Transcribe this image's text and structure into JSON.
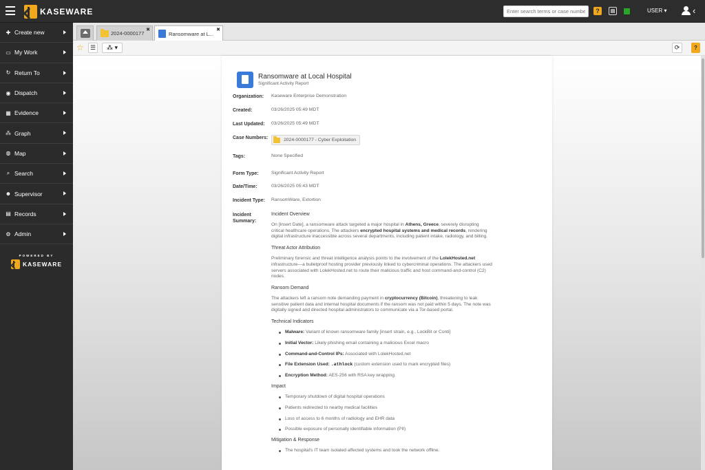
{
  "header": {
    "brand": "KASEWARE",
    "search_placeholder": "Enter search terms or case number",
    "help_icon": "?",
    "user_label": "USER"
  },
  "sidebar": {
    "items": [
      {
        "label": "Create new",
        "icon": "plus-circle-icon"
      },
      {
        "label": "My Work",
        "icon": "inbox-icon"
      },
      {
        "label": "Return To",
        "icon": "return-icon"
      },
      {
        "label": "Dispatch",
        "icon": "dispatch-icon"
      },
      {
        "label": "Evidence",
        "icon": "evidence-icon"
      },
      {
        "label": "Graph",
        "icon": "graph-icon"
      },
      {
        "label": "Map",
        "icon": "map-icon"
      },
      {
        "label": "Search",
        "icon": "search-icon"
      },
      {
        "label": "Supervisor",
        "icon": "supervisor-icon"
      },
      {
        "label": "Records",
        "icon": "records-icon"
      },
      {
        "label": "Admin",
        "icon": "admin-icon"
      }
    ],
    "powered_by": "POWERED BY",
    "powered_brand": "KASEWARE"
  },
  "tabs": {
    "case": "2024-0000177",
    "report": "Ransomware at L..."
  },
  "toolbar": {
    "help": "?"
  },
  "report": {
    "title": "Ransomware at Local Hospital",
    "subtitle": "Significant Activity Report",
    "fields": {
      "organization_label": "Organization:",
      "organization": "Kaseware Enterprise Demonstration",
      "created_label": "Created:",
      "created": "03/26/2025 05:49 MDT",
      "updated_label": "Last Updated:",
      "updated": "03/26/2025 05:49 MDT",
      "case_label": "Case Numbers:",
      "case_number": "2024-0000177 - Cyber Exploitation",
      "tags_label": "Tags:",
      "tags": "None Specified",
      "form_type_label": "Form Type:",
      "form_type": "Significant Activity Report",
      "datetime_label": "Date/Time:",
      "datetime": "03/26/2025 05:43 MDT",
      "incident_type_label": "Incident Type:",
      "incident_type": "RansomWare, Extortion",
      "summary_label": "Incident Summary:"
    },
    "summary": {
      "overview_heading": "Incident Overview",
      "overview_p1": "On [Insert Date], a ransomware attack targeted a major hospital in ",
      "overview_city": "Athens, Greece",
      "overview_p2": ", severely disrupting critical healthcare operations. The attackers ",
      "overview_bold": "encrypted hospital systems and medical records",
      "overview_p3": ", rendering digital infrastructure inaccessible across several departments, including patient intake, radiology, and billing.",
      "attribution_heading": "Threat Actor Attribution",
      "attribution_p1": "Preliminary forensic and threat intelligence analysis points to the involvement of the ",
      "attribution_bold": "LolekHosted.net",
      "attribution_p2": " infrastructure—a bulletproof hosting provider previously linked to cybercriminal operations. The attackers used servers associated with LolekHosted.net to route their malicious traffic and host command-and-control (C2) nodes.",
      "ransom_heading": "Ransom Demand",
      "ransom_p1": "The attackers left a ransom note demanding payment in ",
      "ransom_bold": "cryptocurrency (Bitcoin)",
      "ransom_p2": ", threatening to leak sensitive patient data and internal hospital documents if the ransom was not paid within 5 days. The note was digitally signed and directed hospital administrators to communicate via a Tor-based portal.",
      "indicators_heading": "Technical Indicators",
      "indicators": [
        {
          "label": "Malware:",
          "text": " Variant of known ransomware family [insert strain, e.g., LockBit or Conti]"
        },
        {
          "label": "Initial Vector:",
          "text": " Likely phishing email containing a malicious Excel macro"
        },
        {
          "label": "Command-and-Control IPs:",
          "text": " Associated with LolekHosted.net"
        },
        {
          "label": "File Extension Used:",
          "code": ".athlock",
          "text": " (custom extension used to mark encrypted files)"
        },
        {
          "label": "Encryption Method:",
          "text": " AES-256 with RSA key wrapping"
        }
      ],
      "impact_heading": "Impact",
      "impact": [
        "Temporary shutdown of digital hospital operations",
        "Patients redirected to nearby medical facilities",
        "Loss of access to 6 months of radiology and EHR data",
        "Possible exposure of personally identifiable information (PII)"
      ],
      "mitigation_heading": "Mitigation & Response",
      "mitigation": [
        "The hospital's IT team isolated affected systems and took the network offline."
      ]
    }
  }
}
